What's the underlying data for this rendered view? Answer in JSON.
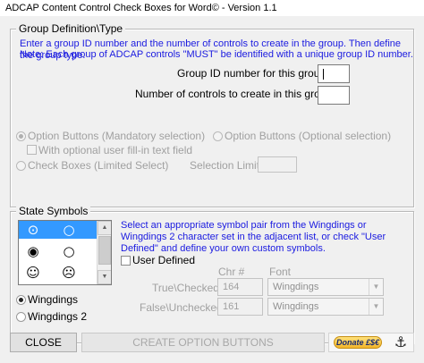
{
  "window": {
    "title": "ADCAP Content Control Check Boxes for Word© - Version 1.1"
  },
  "group_frame": {
    "title": "Group Definition\\Type",
    "info_line1": "Enter a group ID number and the number of controls to create in the group. Then define the group type.",
    "info_line2": "Note: Each group of ADCAP controls \"MUST\" be identified with a unique group ID number.",
    "group_id_label": "Group ID number for this group:",
    "group_id_value": "",
    "num_controls_label": "Number of controls to create in this group:",
    "num_controls_value": "",
    "option_mandatory_label": "Option Buttons (Mandatory selection)",
    "fill_in_label": "With optional user fill-in text field",
    "option_optional_label": "Option Buttons (Optional selection)",
    "check_boxes_label": "Check Boxes (Limited Select)",
    "selection_limit_label": "Selection Limit:",
    "selection_limit_value": ""
  },
  "symbols_frame": {
    "title": "State Symbols",
    "symbol_rows": [
      {
        "checked": "⊙",
        "unchecked": "○",
        "selected": true
      },
      {
        "checked": "◉",
        "unchecked": "○",
        "selected": false
      },
      {
        "checked": "☺",
        "unchecked": "☹",
        "selected": false
      }
    ],
    "info_text": "Select an appropriate symbol pair from the Wingdings or Wingdings 2 character set in the adjacent list, or check \"User Defined\" and define your own custom symbols.",
    "user_defined_label": "User Defined",
    "chr_header": "Chr #",
    "font_header": "Font",
    "true_checked_label": "True\\Checked:",
    "true_checked_chr": "164",
    "true_checked_font": "Wingdings",
    "false_unchecked_label": "False\\Unchecked:",
    "false_unchecked_chr": "161",
    "false_unchecked_font": "Wingdings",
    "wingdings_label": "Wingdings",
    "wingdings2_label": "Wingdings 2"
  },
  "buttons": {
    "close_label": "CLOSE",
    "create_label": "CREATE OPTION BUTTONS",
    "donate_label": "Donate £$€"
  },
  "colors": {
    "info_blue": "#1a1ae0",
    "selection": "#3399ff",
    "donate_gold": "#f3b529"
  }
}
